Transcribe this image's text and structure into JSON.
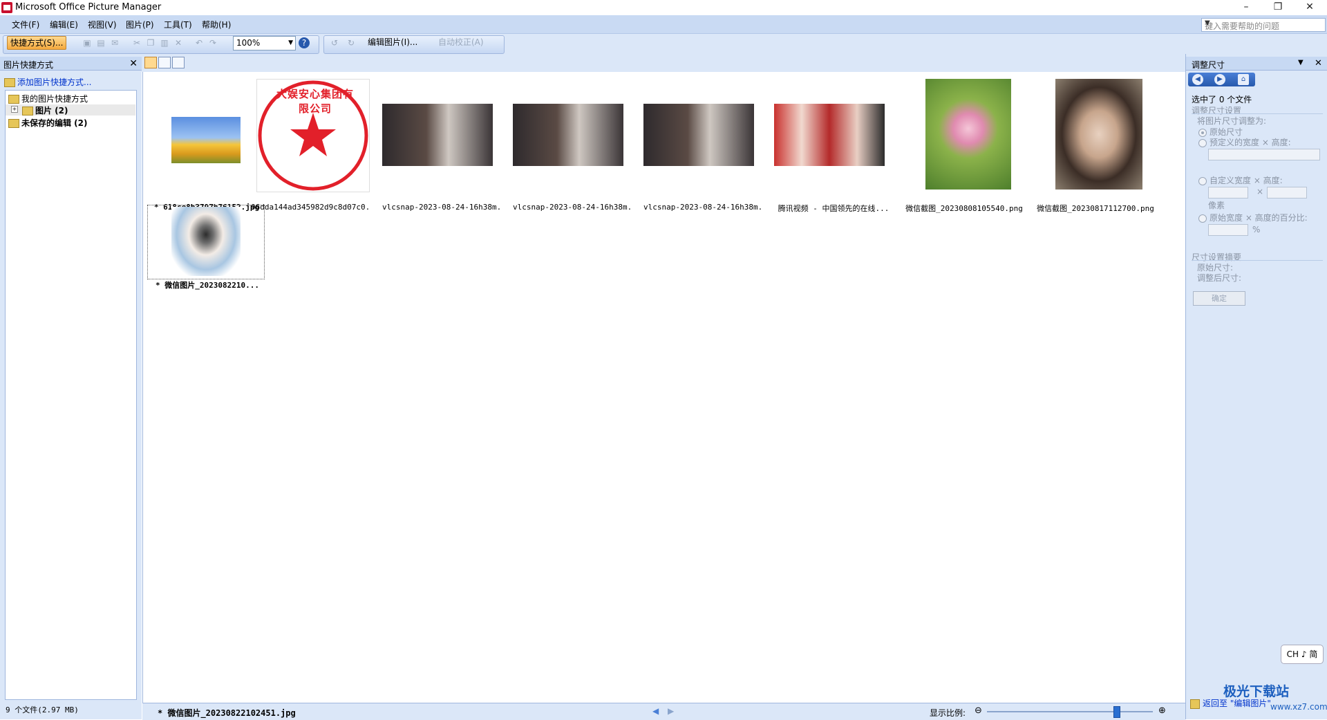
{
  "window": {
    "title": "Microsoft Office Picture Manager",
    "min": "–",
    "restore": "❐",
    "close": "✕"
  },
  "menu": {
    "items": [
      "文件(F)",
      "编辑(E)",
      "视图(V)",
      "图片(P)",
      "工具(T)",
      "帮助(H)"
    ]
  },
  "help_box": {
    "placeholder": "键入需要帮助的问题"
  },
  "toolbar": {
    "shortcut": "快捷方式(S)...",
    "zoom": "100%",
    "edit_picture": "编辑图片(I)...",
    "auto_correct": "自动校正(A)"
  },
  "left_pane": {
    "title": "图片快捷方式",
    "add_shortcut": "添加图片快捷方式...",
    "root": "我的图片快捷方式",
    "pictures": "图片 (2)",
    "unsaved": "未保存的编辑 (2)",
    "file_count": "9 个文件(2.97 MB)"
  },
  "thumbnails": [
    {
      "caption": "* 618ce8b3797b76152.jpg",
      "kind": "tulips",
      "bold": true
    },
    {
      "caption": "96dda144ad345982d9c8d07c0...",
      "kind": "seal",
      "bold": false
    },
    {
      "caption": "vlcsnap-2023-08-24-16h38m...",
      "kind": "bedroom",
      "bold": false
    },
    {
      "caption": "vlcsnap-2023-08-24-16h38m...",
      "kind": "bedroom",
      "bold": false
    },
    {
      "caption": "vlcsnap-2023-08-24-16h38m...",
      "kind": "bedroom",
      "bold": false
    },
    {
      "caption": "腾讯视频 - 中国领先的在线...",
      "kind": "people",
      "bold": false
    },
    {
      "caption": "微信截图_20230808105540.png",
      "kind": "lotus",
      "bold": false
    },
    {
      "caption": "微信截图_20230817112700.png",
      "kind": "portrait",
      "bold": false
    },
    {
      "caption": "* 微信图片_2023082210...",
      "kind": "sketch",
      "bold": true
    }
  ],
  "seal": {
    "text": "大娱安心集团有限公司"
  },
  "status": {
    "current_file": "* 微信图片_20230822102451.jpg",
    "zoom_label": "显示比例:",
    "zoom_fraction": 0.78
  },
  "right_pane": {
    "title": "调整尺寸",
    "selected": "选中了 0 个文件",
    "section_settings": "调整尺寸设置",
    "resize_to": "将图片尺寸调整为:",
    "opt_original": "原始尺寸",
    "opt_predefined": "预定义的宽度 × 高度:",
    "opt_custom": "自定义宽度 × 高度:",
    "pixels": "像素",
    "opt_percent": "原始宽度 × 高度的百分比:",
    "percent": "%",
    "x": "×",
    "section_summary": "尺寸设置摘要",
    "original_size": "原始尺寸:",
    "new_size": "调整后尺寸:",
    "ok": "确定",
    "back": "返回至 \"编辑图片\""
  },
  "ime": {
    "label": "CH ♪ 简"
  },
  "watermark": {
    "text": "极光下载站",
    "url": "www.xz7.com"
  }
}
